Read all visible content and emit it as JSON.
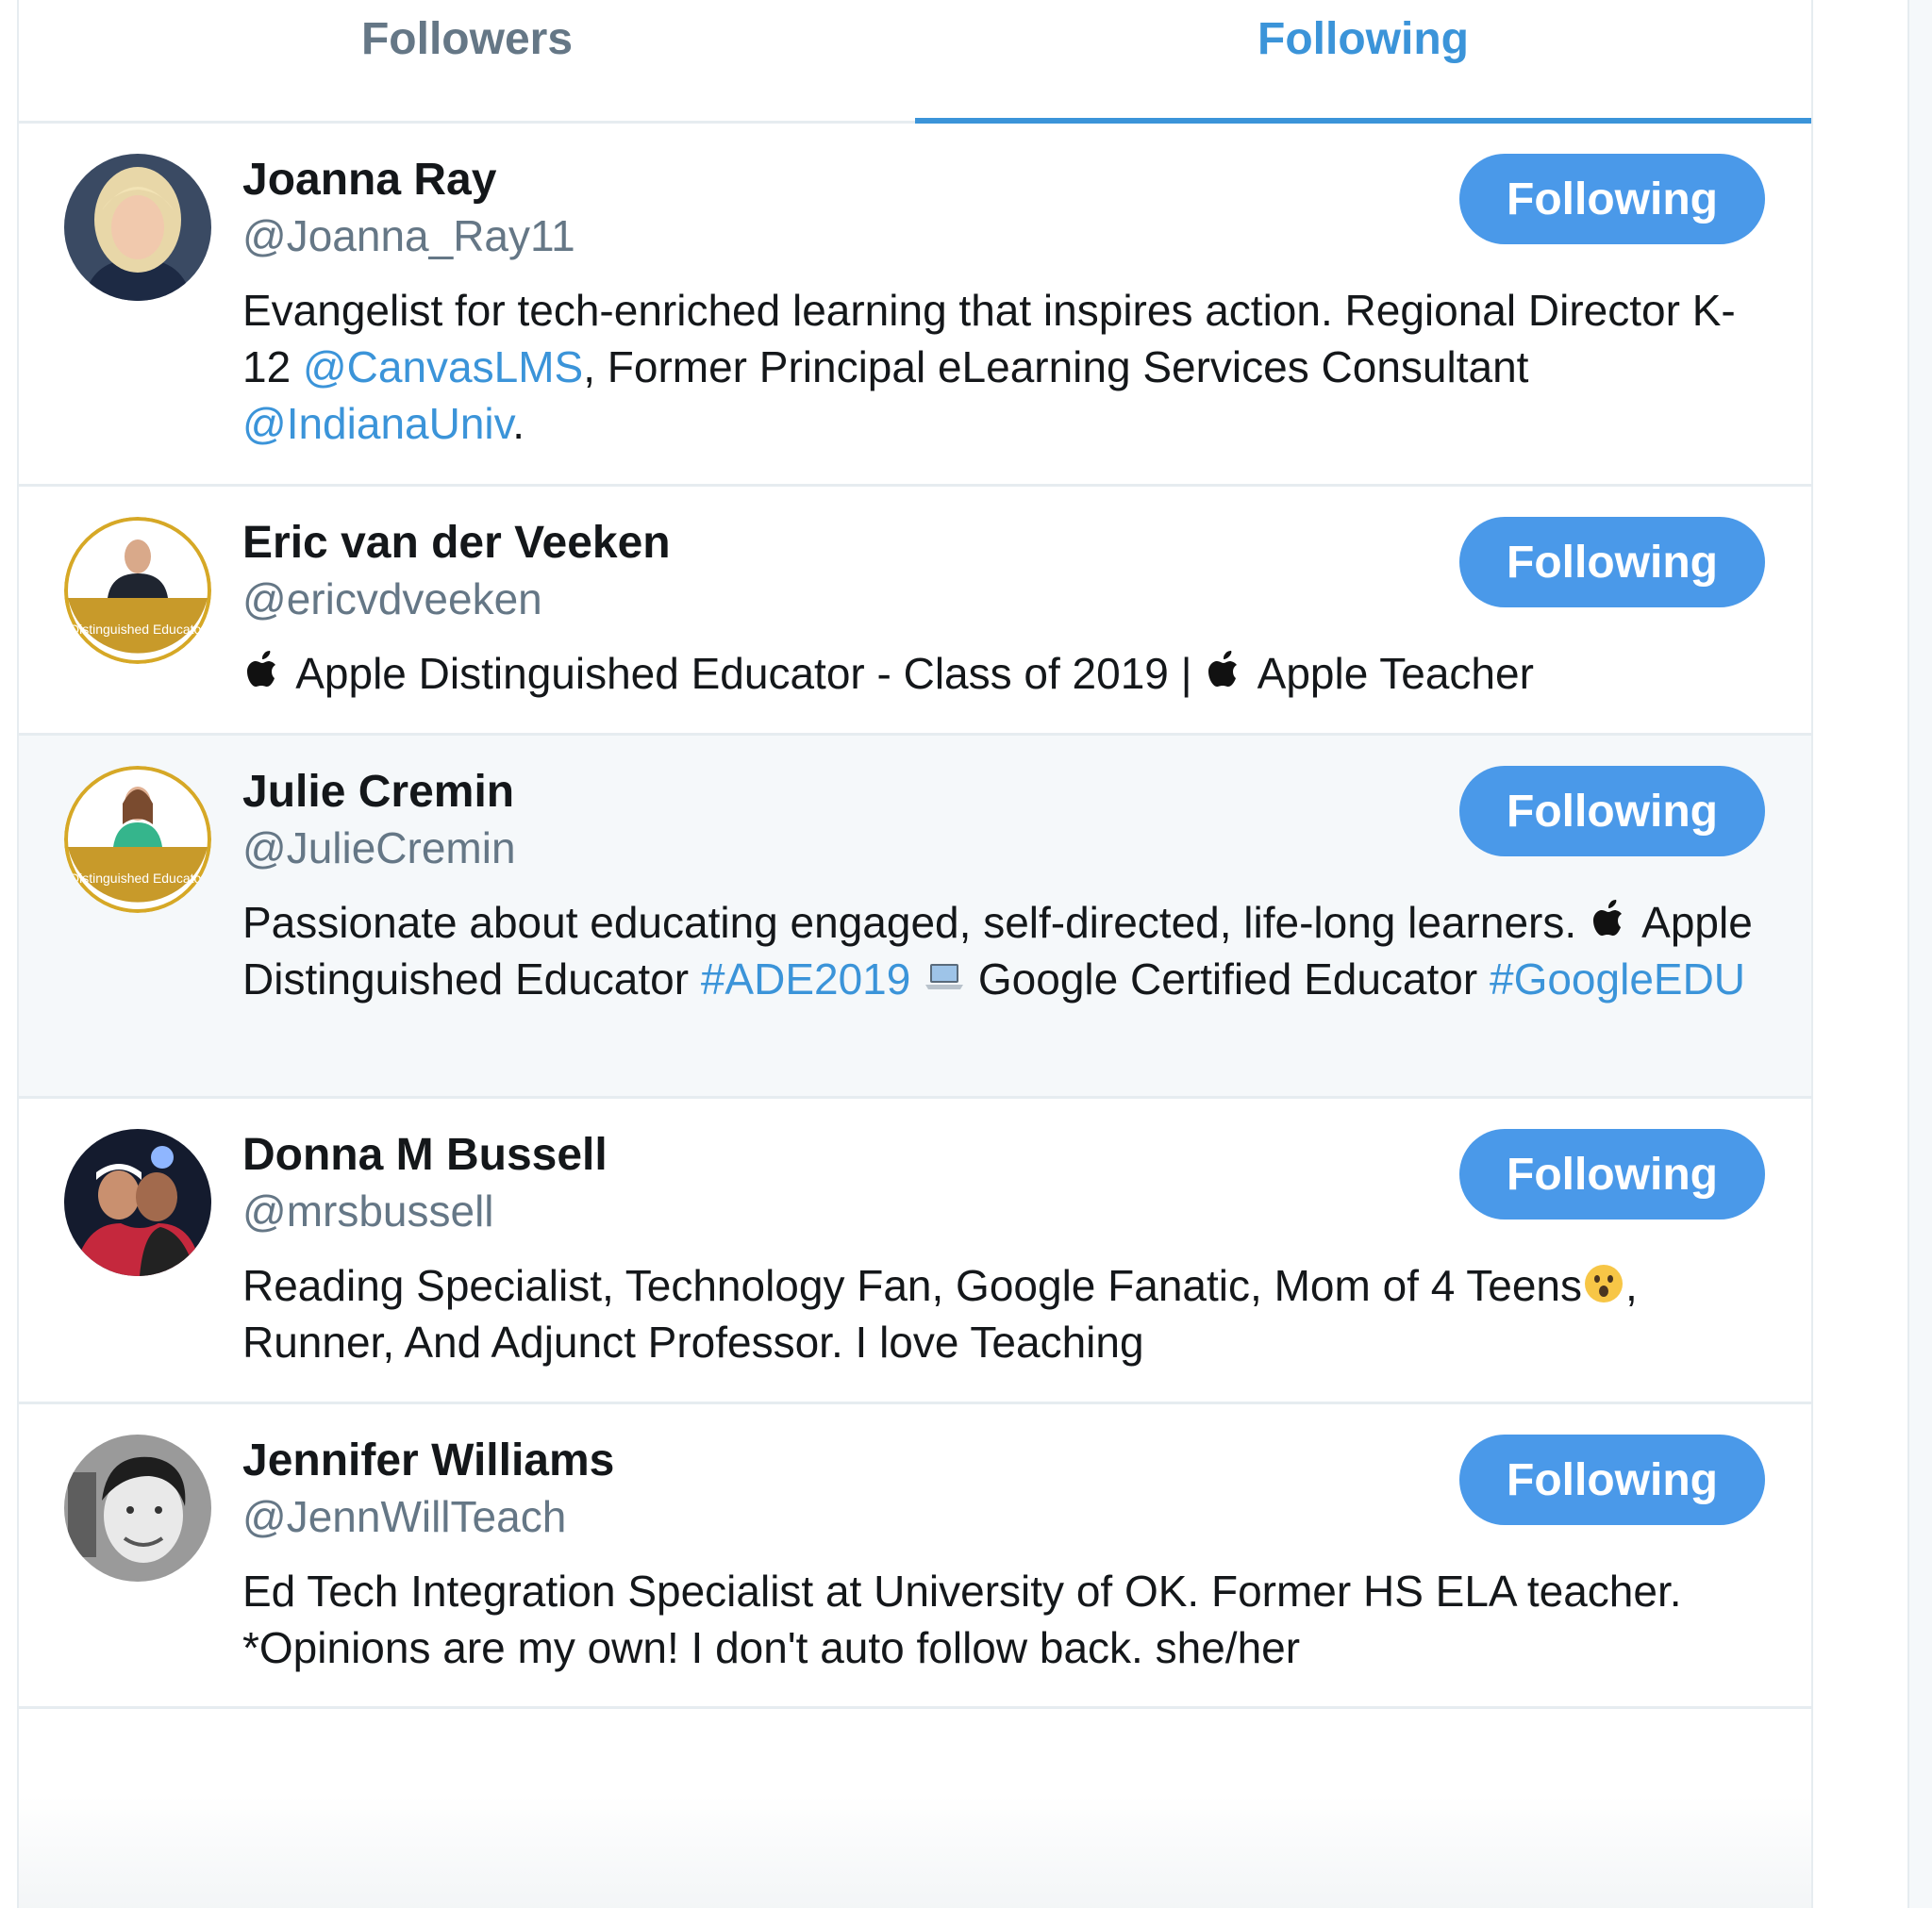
{
  "tabs": {
    "followers_label": "Followers",
    "following_label": "Following"
  },
  "users": [
    {
      "name": "Joanna Ray",
      "handle": "@Joanna_Ray11",
      "button_label": "Following",
      "bio": [
        {
          "t": "Evangelist for tech-enriched learning that inspires action. Regional Director K-12 "
        },
        {
          "t": "@CanvasLMS",
          "link": true
        },
        {
          "t": ", Former Principal eLearning Services Consultant "
        },
        {
          "t": "@IndianaUniv",
          "link": true
        },
        {
          "t": "."
        }
      ]
    },
    {
      "name": "Eric van der Veeken",
      "handle": "@ericvdveeken",
      "button_label": "Following",
      "badge_text": "Distinguished Educator",
      "bio": [
        {
          "icon": "apple-logo-icon"
        },
        {
          "t": " Apple Distinguished Educator - Class of 2019 | "
        },
        {
          "icon": "apple-logo-icon"
        },
        {
          "t": " Apple Teacher"
        }
      ]
    },
    {
      "name": "Julie Cremin",
      "handle": "@JulieCremin",
      "button_label": "Following",
      "badge_text": "Distinguished Educator",
      "bio": [
        {
          "t": "Passionate about educating engaged, self-directed, life-long learners. "
        },
        {
          "icon": "apple-logo-icon"
        },
        {
          "t": " Apple Distinguished Educator "
        },
        {
          "t": "#ADE2019",
          "link": true
        },
        {
          "t": " "
        },
        {
          "icon": "laptop-emoji-icon"
        },
        {
          "t": " Google Certified Educator "
        },
        {
          "t": "#GoogleEDU",
          "link": true
        }
      ]
    },
    {
      "name": "Donna M Bussell",
      "handle": "@mrsbussell",
      "button_label": "Following",
      "bio": [
        {
          "t": "Reading Specialist, Technology Fan, Google Fanatic, Mom of 4 Teens"
        },
        {
          "icon": "surprised-face-emoji-icon"
        },
        {
          "t": ", Runner, And Adjunct Professor. I love Teaching"
        }
      ]
    },
    {
      "name": "Jennifer Williams",
      "handle": "@JennWillTeach",
      "button_label": "Following",
      "bio": [
        {
          "t": "Ed Tech Integration Specialist at University of OK. Former HS ELA teacher. *Opinions are my own! I don't auto follow back. she/her"
        }
      ]
    }
  ],
  "colors": {
    "accent": "#3b94d9",
    "button_bg": "#4a99e9",
    "muted": "#657786",
    "border": "#e6ecf0"
  }
}
